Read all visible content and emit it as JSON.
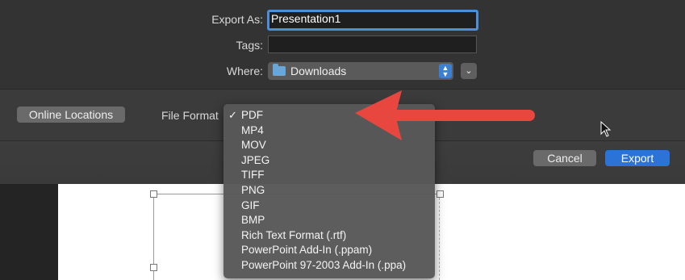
{
  "dialog": {
    "export_as_label": "Export As:",
    "export_as_value": "Presentation1",
    "tags_label": "Tags:",
    "tags_value": "",
    "where_label": "Where:",
    "where_value": "Downloads",
    "where_icon": "folder-icon",
    "online_locations_label": "Online Locations",
    "file_format_label": "File Format",
    "cancel_label": "Cancel",
    "export_label": "Export"
  },
  "file_format_menu": {
    "selected": "PDF",
    "items": [
      {
        "label": "PDF",
        "checked": "✓"
      },
      {
        "label": "MP4",
        "checked": ""
      },
      {
        "label": "MOV",
        "checked": ""
      },
      {
        "label": "JPEG",
        "checked": ""
      },
      {
        "label": "TIFF",
        "checked": ""
      },
      {
        "label": "PNG",
        "checked": ""
      },
      {
        "label": "GIF",
        "checked": ""
      },
      {
        "label": "BMP",
        "checked": ""
      },
      {
        "label": "Rich Text Format (.rtf)",
        "checked": ""
      },
      {
        "label": "PowerPoint Add-In (.ppam)",
        "checked": ""
      },
      {
        "label": "PowerPoint 97-2003 Add-In (.ppa)",
        "checked": ""
      }
    ]
  },
  "colors": {
    "accent_blue": "#2b73d6",
    "focus_ring": "#4a8fd8",
    "annotation_arrow": "#e8473f"
  }
}
